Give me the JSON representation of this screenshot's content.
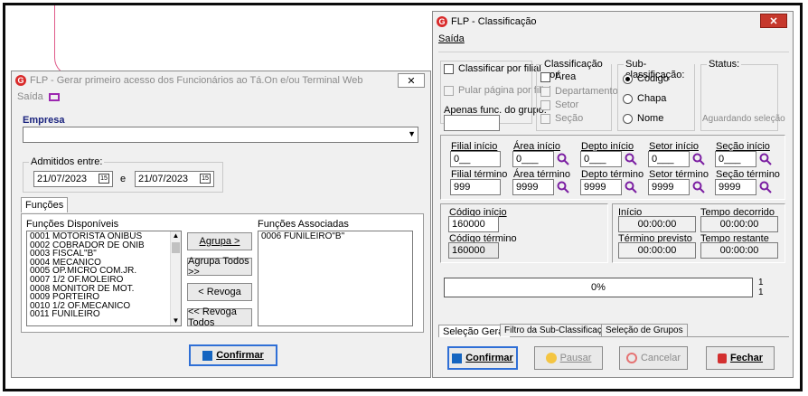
{
  "left": {
    "title": "FLP - Gerar primeiro acesso dos Funcionários ao Tá.On e/ou Terminal Web",
    "menu_saida": "Saída",
    "empresa_label": "Empresa",
    "empresa_value": "",
    "admitidos_label": "Admitidos entre:",
    "date_from": "21/07/2023",
    "date_sep": "e",
    "date_to": "21/07/2023",
    "funcoes_tab": "Funções",
    "disponiveis_label": "Funções Disponíveis",
    "associadas_label": "Funções Associadas",
    "disponiveis": [
      "0001 MOTORISTA ONIBUS",
      "0002 COBRADOR DE ONIB",
      "0003 FISCAL\"B\"",
      "0004 MECANICO",
      "0005 OP.MICRO COM.JR.",
      "0007 1/2 OF.MOLEIRO",
      "0008 MONITOR DE MOT.",
      "0009 PORTEIRO",
      "0010 1/2 OF.MECANICO",
      "0011 FUNILEIRO"
    ],
    "associadas": [
      "0006 FUNILEIRO\"B\""
    ],
    "btn_agrupa": "Agrupa >",
    "btn_agrupa_todos": "Agrupa Todos >>",
    "btn_revoga": "< Revoga",
    "btn_revoga_todos": "<< Revoga Todos",
    "btn_confirmar": "Confirmar",
    "close": "✕"
  },
  "right": {
    "title": "FLP - Classificação",
    "menu_saida": "Saída",
    "classificar_filial": "Classificar por filial",
    "pular_pagina": "Pular página por filial",
    "apenas_func": "Apenas func. do grupo:",
    "apenas_value": "",
    "classificacao_por": "Classificação  por:",
    "class_area": "Área",
    "class_departamento": "Departamento",
    "class_setor": "Setor",
    "class_secao": "Seção",
    "subclass_label": "Sub-classificação:",
    "sub_codigo": "Codigo",
    "sub_chapa": "Chapa",
    "sub_nome": "Nome",
    "status_label": "Status:",
    "status_value": "Aguardando seleção",
    "filial_inicio": "Filial início",
    "filial_inicio_v": "0__",
    "filial_termino": "Filial término",
    "filial_termino_v": "999",
    "area_inicio": "Área início",
    "area_inicio_v": "0___",
    "area_termino": "Área término",
    "area_termino_v": "9999",
    "depto_inicio": "Depto início",
    "depto_inicio_v": "0___",
    "depto_termino": "Depto término",
    "depto_termino_v": "9999",
    "setor_inicio": "Setor início",
    "setor_inicio_v": "0___",
    "setor_termino": "Setor término",
    "setor_termino_v": "9999",
    "secao_inicio": "Seção início",
    "secao_inicio_v": "0___",
    "secao_termino": "Seção término",
    "secao_termino_v": "9999",
    "codigo_inicio": "Código início",
    "codigo_inicio_v": "160000",
    "codigo_termino": "Código término",
    "codigo_termino_v": "160000",
    "inicio": "Início",
    "inicio_v": "00:00:00",
    "tempo_decorrido": "Tempo decorrido",
    "tempo_decorrido_v": "00:00:00",
    "termino_previsto": "Término previsto",
    "termino_previsto_v": "00:00:00",
    "tempo_restante": "Tempo restante",
    "tempo_restante_v": "00:00:00",
    "progress_text": "0%",
    "progress": 0,
    "progress_side_1": "1",
    "progress_side_2": "1",
    "tab_selecao_geral": "Seleção Geral",
    "tab_filtro_sub": "Filtro da Sub-Classificação",
    "tab_selecao_grupos": "Seleção de Grupos",
    "btn_confirmar": "Confirmar",
    "btn_pausar": "Pausar",
    "btn_cancelar": "Cancelar",
    "btn_fechar": "Fechar",
    "close": "✕"
  },
  "colors": {
    "accent_purple": "#7b1fa2",
    "close_red": "#c6382c",
    "logo_red": "#d92b2b"
  }
}
